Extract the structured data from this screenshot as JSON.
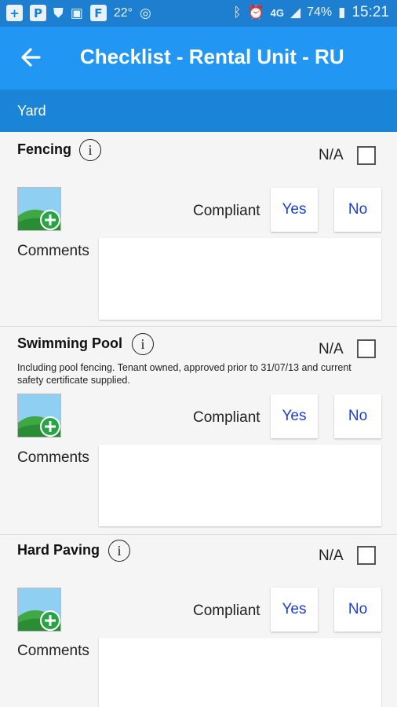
{
  "status_bar": {
    "temperature": "22°",
    "network": "4G",
    "battery": "74%",
    "time": "15:21"
  },
  "app_bar": {
    "title": "Checklist - Rental Unit - RU"
  },
  "section": {
    "title": "Yard"
  },
  "items": [
    {
      "name": "Fencing",
      "na_label": "N/A",
      "na_checked": false,
      "description": "",
      "compliant_label": "Compliant",
      "yes_label": "Yes",
      "no_label": "No",
      "comments_label": "Comments",
      "comments_value": ""
    },
    {
      "name": "Swimming Pool",
      "na_label": "N/A",
      "na_checked": false,
      "description": "Including pool fencing. Tenant owned, approved prior to 31/07/13 and current safety certificate supplied.",
      "compliant_label": "Compliant",
      "yes_label": "Yes",
      "no_label": "No",
      "comments_label": "Comments",
      "comments_value": ""
    },
    {
      "name": "Hard Paving",
      "na_label": "N/A",
      "na_checked": false,
      "description": "",
      "compliant_label": "Compliant",
      "yes_label": "Yes",
      "no_label": "No",
      "comments_label": "Comments",
      "comments_value": ""
    }
  ],
  "colors": {
    "status_bar": "#1e7fd0",
    "app_bar": "#2196f3",
    "section_header": "#1a85d6",
    "button_text": "#1a3fd0"
  },
  "icons": {
    "back": "arrow-left",
    "info": "info-circle",
    "add_photo": "image-plus"
  }
}
